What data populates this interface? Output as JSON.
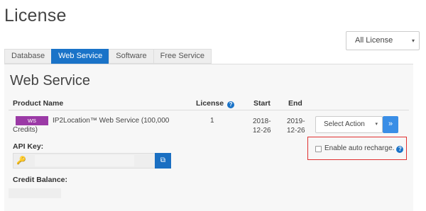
{
  "page": {
    "title": "License"
  },
  "filter": {
    "selected": "All License",
    "caret": "▾"
  },
  "tabs": [
    {
      "label": "Database",
      "active": false
    },
    {
      "label": "Web Service",
      "active": true
    },
    {
      "label": "Software",
      "active": false
    },
    {
      "label": "Free Service",
      "active": false
    }
  ],
  "section": {
    "title": "Web Service",
    "columns": {
      "product": "Product Name",
      "license": "License",
      "start": "Start",
      "end": "End"
    },
    "row": {
      "badge": "WS",
      "product_name": "IP2Location™ Web Service (100,000 Credits)",
      "license": "1",
      "start": "2018-12-26",
      "end": "2019-12-26",
      "action_placeholder": "Select Action",
      "action_caret": "▾",
      "go_label": "»"
    },
    "api_key_label": "API Key:",
    "api_key_value": "",
    "auto_recharge_label": "Enable auto recharge.",
    "credit_balance_label": "Credit Balance:"
  },
  "icons": {
    "help": "?",
    "key": "🔑",
    "copy": "⧉"
  },
  "colors": {
    "accent": "#1a73c8",
    "badge": "#9b3aa6",
    "highlight": "#e03030"
  }
}
